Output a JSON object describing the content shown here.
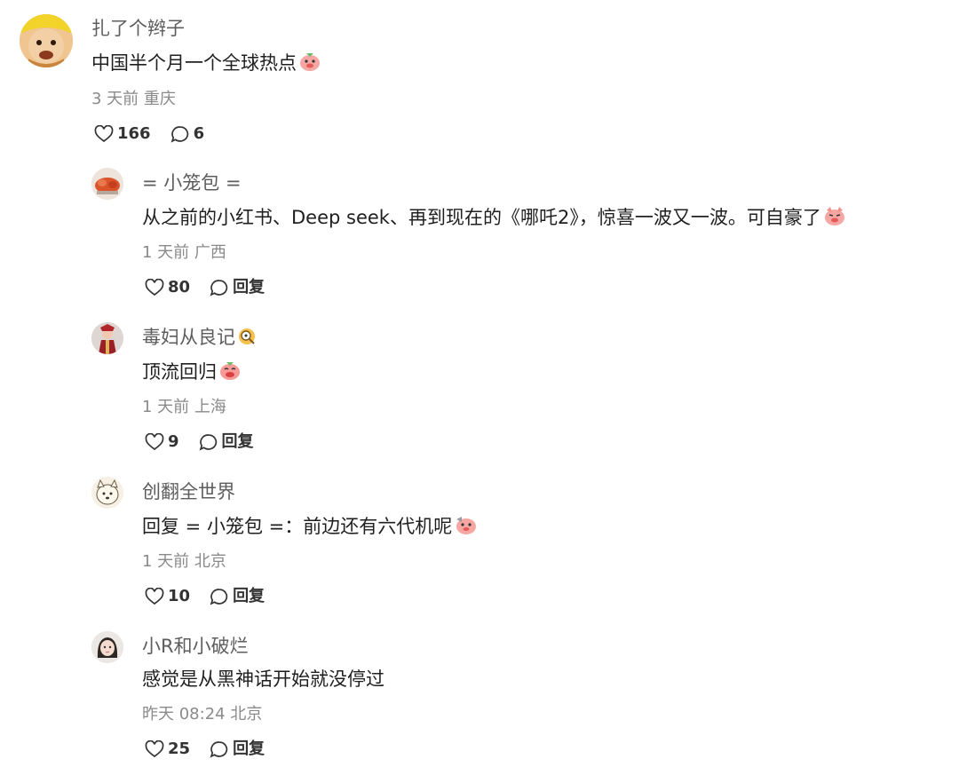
{
  "colors": {
    "name": "#5d5d5d",
    "text": "#1f1f1f",
    "meta": "#8a8a8a",
    "action": "#333333"
  },
  "comments": [
    {
      "author": "扎了个辫子",
      "text": "中国半个月一个全球热点",
      "emoji": "pig-laugh-emoji",
      "meta": "3 天前 重庆",
      "likes": "166",
      "reply_label": "6",
      "avatar": "child-avatar"
    },
    {
      "author": "= 小笼包 =",
      "text": "从之前的小红书、Deep seek、再到现在的《哪吒2》，惊喜一波又一波。可自豪了",
      "emoji": "pig-proud-emoji",
      "meta": "1 天前 广西",
      "likes": "80",
      "reply_label": "回复",
      "avatar": "food-avatar"
    },
    {
      "author": "毒妇从良记",
      "author_emoji": "magnifier-face-emoji",
      "text": "顶流回归",
      "emoji": "pig-laugh-emoji",
      "meta": "1 天前 上海",
      "likes": "9",
      "reply_label": "回复",
      "avatar": "costume-avatar"
    },
    {
      "author": "创翻全世界",
      "text": "回复 = 小笼包 =：前边还有六代机呢",
      "emoji": "pig-thinking-emoji",
      "meta": "1 天前 北京",
      "likes": "10",
      "reply_label": "回复",
      "avatar": "cartoon-dog-avatar"
    },
    {
      "author": "小R和小破烂",
      "text": "感觉是从黑神话开始就没停过",
      "meta": "昨天 08:24 北京",
      "likes": "25",
      "reply_label": "回复",
      "avatar": "girl-avatar"
    }
  ]
}
